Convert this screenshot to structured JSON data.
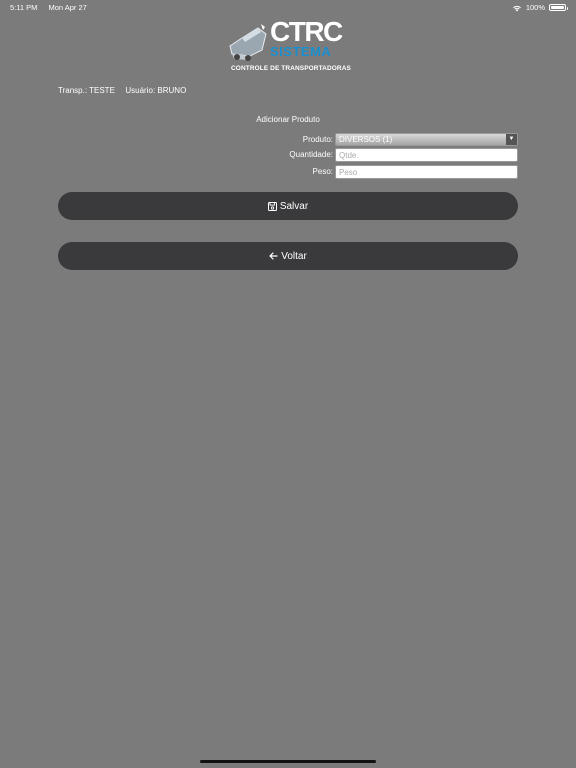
{
  "status_bar": {
    "time": "5:11 PM",
    "date": "Mon Apr 27",
    "battery": "100%",
    "battery_level": 1.0
  },
  "logo": {
    "title": "CTRC",
    "subtitle": "SISTEMA",
    "tagline": "CONTROLE DE TRANSPORTADORAS"
  },
  "info": {
    "transp_label": "Transp.:",
    "transp_value": "TESTE",
    "usuario_label": "Usuário:",
    "usuario_value": "BRUNO"
  },
  "form": {
    "title": "Adicionar Produto",
    "produto_label": "Produto:",
    "produto_selected": "DIVERSOS (1)",
    "quantidade_label": "Quantidade:",
    "quantidade_placeholder": "Qtde.",
    "peso_label": "Peso:",
    "peso_placeholder": "Peso"
  },
  "buttons": {
    "save_label": "Salvar",
    "back_label": "Voltar"
  },
  "colors": {
    "background": "#7b7b7b",
    "button": "#3a3a3c",
    "brand_blue": "#1a8fd0"
  },
  "icons": {
    "save": "floppy-disk-icon",
    "back": "arrow-left-icon",
    "wifi": "wifi-icon",
    "battery": "battery-icon"
  }
}
